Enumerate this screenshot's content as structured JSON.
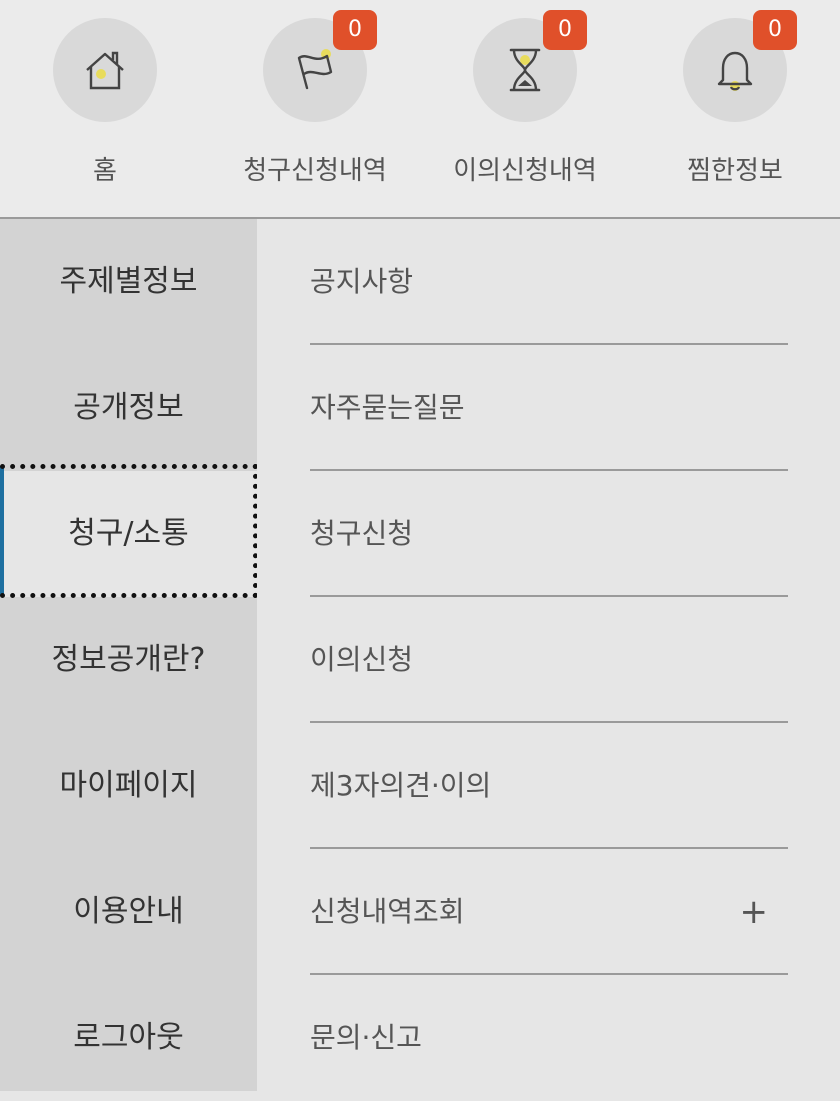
{
  "quick_menu": [
    {
      "name": "home",
      "label": "홈",
      "icon": "house-icon"
    },
    {
      "name": "claim-history",
      "label": "청구신청내역",
      "icon": "flag-icon",
      "badge": "0"
    },
    {
      "name": "objection-history",
      "label": "이의신청내역",
      "icon": "hourglass-icon",
      "badge": "0"
    },
    {
      "name": "bookmarks",
      "label": "찜한정보",
      "icon": "bell-icon",
      "badge": "0"
    }
  ],
  "categories": [
    {
      "label": "주제별정보"
    },
    {
      "label": "공개정보"
    },
    {
      "label": "청구/소통",
      "active": true
    },
    {
      "label": "정보공개란?"
    },
    {
      "label": "마이페이지"
    },
    {
      "label": "이용안내"
    },
    {
      "label": "로그아웃"
    }
  ],
  "submenu": [
    {
      "label": "공지사항"
    },
    {
      "label": "자주묻는질문"
    },
    {
      "label": "청구신청"
    },
    {
      "label": "이의신청"
    },
    {
      "label": "제3자의견·이의"
    },
    {
      "label": "신청내역조회",
      "expand": "+"
    },
    {
      "label": "문의·신고"
    }
  ],
  "colors": {
    "badge": "#e0502a",
    "icon_accent": "#e8dc5c",
    "left_column": "#d3d3d3",
    "background": "#e6e6e6"
  }
}
